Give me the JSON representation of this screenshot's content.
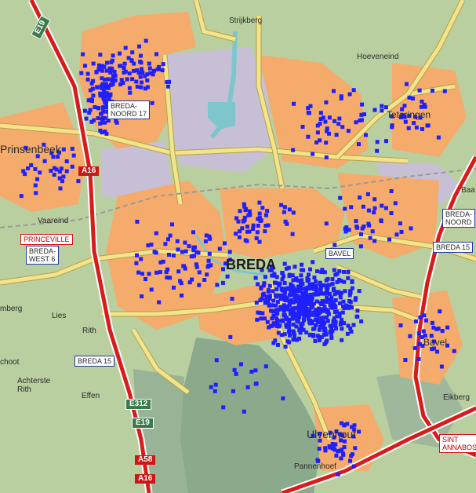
{
  "map": {
    "colors": {
      "countryside": "#b9cfa0",
      "urban": "#f4ab6c",
      "industrial": "#c7bfd6",
      "road": "#f3e38b",
      "motorway": "#d81c1c",
      "water": "#7fc6cc",
      "forest": "#8ba98b",
      "marker": "#1f1fff"
    },
    "place_labels": [
      {
        "key": "strijkberg",
        "text": "Strijkberg"
      },
      {
        "key": "hoeveneind",
        "text": "Hoeveneind"
      },
      {
        "key": "teteringen",
        "text": "Teteringen"
      },
      {
        "key": "prinsenbeek",
        "text": "Prinsenbeek"
      },
      {
        "key": "vaareind",
        "text": "Vaareind"
      },
      {
        "key": "breda",
        "text": "BREDA"
      },
      {
        "key": "bavel",
        "text": "Bavel"
      },
      {
        "key": "emberg",
        "text": "mberg"
      },
      {
        "key": "lies",
        "text": "Lies"
      },
      {
        "key": "rith",
        "text": "Rith"
      },
      {
        "key": "schoot",
        "text": "choot"
      },
      {
        "key": "achterste-rith",
        "text": "Achterste\nRith"
      },
      {
        "key": "effen",
        "text": "Effen"
      },
      {
        "key": "eikberg",
        "text": "Eikberg"
      },
      {
        "key": "ulvenhout",
        "text": "Ulvenhout"
      },
      {
        "key": "pannenhoef",
        "text": "Pannenhoef"
      }
    ],
    "route_shields": [
      {
        "key": "e19-top",
        "text": "E19",
        "style": "green"
      },
      {
        "key": "a16-mid",
        "text": "A16",
        "style": "red"
      },
      {
        "key": "e312",
        "text": "E312",
        "style": "green"
      },
      {
        "key": "e19-bottom",
        "text": "E19",
        "style": "green"
      },
      {
        "key": "a58",
        "text": "A58",
        "style": "red"
      },
      {
        "key": "a16-bottom",
        "text": "A16",
        "style": "red"
      }
    ],
    "exit_signs": [
      {
        "key": "breda-noord-17",
        "text": "BREDA-\nNOORD 17",
        "style": "blue"
      },
      {
        "key": "princeville",
        "text": "PRINCEVILLE",
        "style": "red"
      },
      {
        "key": "breda-west-6",
        "text": "BREDA-\nWEST 6",
        "style": "blue"
      },
      {
        "key": "breda-15-left",
        "text": "BREDA 15",
        "style": "blue"
      },
      {
        "key": "bavel-sign",
        "text": "BAVEL",
        "style": "blue"
      },
      {
        "key": "breda-noord-right",
        "text": "BREDA-\nNOORD",
        "style": "blue"
      },
      {
        "key": "breda-15-right",
        "text": "BREDA 15",
        "style": "blue"
      },
      {
        "key": "sint-annabosch",
        "text": "SINT\nANNABOS",
        "style": "red"
      },
      {
        "key": "baa",
        "text": "Baa",
        "style": "none"
      }
    ]
  }
}
